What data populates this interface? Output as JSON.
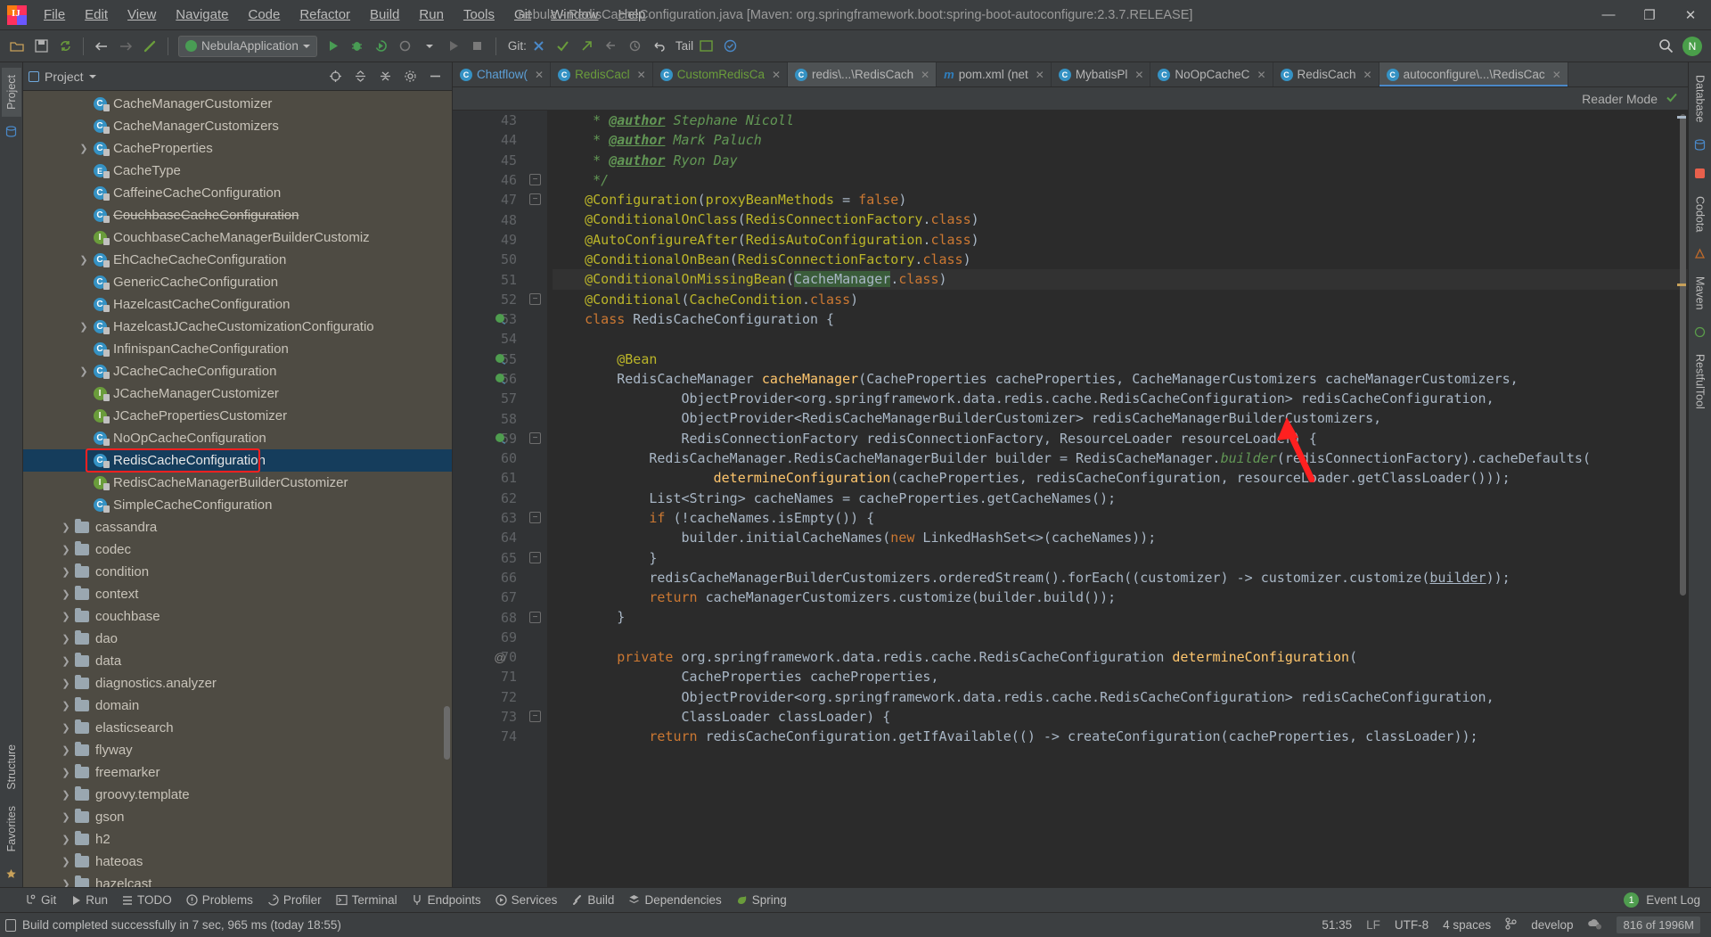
{
  "window": {
    "title": "nebula - RedisCacheConfiguration.java [Maven: org.springframework.boot:spring-boot-autoconfigure:2.3.7.RELEASE]",
    "minimize": "—",
    "maximize": "❐",
    "close": "✕"
  },
  "menu": [
    {
      "label": "File"
    },
    {
      "label": "Edit"
    },
    {
      "label": "View"
    },
    {
      "label": "Navigate"
    },
    {
      "label": "Code"
    },
    {
      "label": "Refactor"
    },
    {
      "label": "Build"
    },
    {
      "label": "Run"
    },
    {
      "label": "Tools"
    },
    {
      "label": "Git"
    },
    {
      "label": "Window"
    },
    {
      "label": "Help"
    }
  ],
  "toolbar": {
    "run_config": "NebulaApplication",
    "git_label": "Git:",
    "tail_label": "Tail",
    "avatar_initial": "N"
  },
  "left_rail": {
    "project": "Project",
    "structure": "Structure",
    "favorites": "Favorites"
  },
  "right_rail": {
    "database": "Database",
    "codota": "Codota",
    "maven": "Maven",
    "restful": "RestfulTool"
  },
  "project_panel": {
    "title": "Project",
    "tree": [
      {
        "indent": 3,
        "icon": "class",
        "label": "CacheManagerCustomizer",
        "twist": false,
        "clipped": true
      },
      {
        "indent": 3,
        "icon": "class",
        "label": "CacheManagerCustomizers",
        "twist": false
      },
      {
        "indent": 3,
        "icon": "class",
        "label": "CacheProperties",
        "twist": true
      },
      {
        "indent": 3,
        "icon": "enum",
        "label": "CacheType",
        "twist": false
      },
      {
        "indent": 3,
        "icon": "class",
        "label": "CaffeineCacheConfiguration",
        "twist": false
      },
      {
        "indent": 3,
        "icon": "class",
        "label": "CouchbaseCacheConfiguration",
        "twist": false,
        "strike": true
      },
      {
        "indent": 3,
        "icon": "iface",
        "label": "CouchbaseCacheManagerBuilderCustomiz",
        "twist": false
      },
      {
        "indent": 3,
        "icon": "class",
        "label": "EhCacheCacheConfiguration",
        "twist": true
      },
      {
        "indent": 3,
        "icon": "class",
        "label": "GenericCacheConfiguration",
        "twist": false
      },
      {
        "indent": 3,
        "icon": "class",
        "label": "HazelcastCacheConfiguration",
        "twist": false
      },
      {
        "indent": 3,
        "icon": "class",
        "label": "HazelcastJCacheCustomizationConfiguratio",
        "twist": true
      },
      {
        "indent": 3,
        "icon": "class",
        "label": "InfinispanCacheConfiguration",
        "twist": false
      },
      {
        "indent": 3,
        "icon": "class",
        "label": "JCacheCacheConfiguration",
        "twist": true
      },
      {
        "indent": 3,
        "icon": "iface",
        "label": "JCacheManagerCustomizer",
        "twist": false
      },
      {
        "indent": 3,
        "icon": "iface",
        "label": "JCachePropertiesCustomizer",
        "twist": false
      },
      {
        "indent": 3,
        "icon": "class",
        "label": "NoOpCacheConfiguration",
        "twist": false
      },
      {
        "indent": 3,
        "icon": "class",
        "label": "RedisCacheConfiguration",
        "twist": false,
        "selected": true,
        "highlight": true
      },
      {
        "indent": 3,
        "icon": "iface",
        "label": "RedisCacheManagerBuilderCustomizer",
        "twist": false
      },
      {
        "indent": 3,
        "icon": "class",
        "label": "SimpleCacheConfiguration",
        "twist": false
      },
      {
        "indent": 2,
        "icon": "folder",
        "label": "cassandra",
        "twist": true
      },
      {
        "indent": 2,
        "icon": "folder",
        "label": "codec",
        "twist": true
      },
      {
        "indent": 2,
        "icon": "folder",
        "label": "condition",
        "twist": true
      },
      {
        "indent": 2,
        "icon": "folder",
        "label": "context",
        "twist": true
      },
      {
        "indent": 2,
        "icon": "folder",
        "label": "couchbase",
        "twist": true
      },
      {
        "indent": 2,
        "icon": "folder",
        "label": "dao",
        "twist": true
      },
      {
        "indent": 2,
        "icon": "folder",
        "label": "data",
        "twist": true
      },
      {
        "indent": 2,
        "icon": "folder",
        "label": "diagnostics.analyzer",
        "twist": true
      },
      {
        "indent": 2,
        "icon": "folder",
        "label": "domain",
        "twist": true
      },
      {
        "indent": 2,
        "icon": "folder",
        "label": "elasticsearch",
        "twist": true
      },
      {
        "indent": 2,
        "icon": "folder",
        "label": "flyway",
        "twist": true
      },
      {
        "indent": 2,
        "icon": "folder",
        "label": "freemarker",
        "twist": true
      },
      {
        "indent": 2,
        "icon": "folder",
        "label": "groovy.template",
        "twist": true
      },
      {
        "indent": 2,
        "icon": "folder",
        "label": "gson",
        "twist": true
      },
      {
        "indent": 2,
        "icon": "folder",
        "label": "h2",
        "twist": true
      },
      {
        "indent": 2,
        "icon": "folder",
        "label": "hateoas",
        "twist": true
      },
      {
        "indent": 2,
        "icon": "folder",
        "label": "hazelcast",
        "twist": true
      }
    ]
  },
  "editor_tabs": [
    {
      "label": "Chatflow(",
      "icon": "class",
      "color": "blue",
      "active": false
    },
    {
      "label": "RedisCacl",
      "icon": "class",
      "color": "green",
      "active": false
    },
    {
      "label": "CustomRedisCa",
      "icon": "class",
      "color": "green",
      "active": false
    },
    {
      "label": "redis\\...\\RedisCach",
      "icon": "class",
      "color": "grey",
      "active": true
    },
    {
      "label": "pom.xml (net",
      "icon": "maven",
      "color": "grey",
      "active": false
    },
    {
      "label": "MybatisPl",
      "icon": "class",
      "color": "grey",
      "active": false
    },
    {
      "label": "NoOpCacheC",
      "icon": "class",
      "color": "grey",
      "active": false
    },
    {
      "label": "RedisCach",
      "icon": "class",
      "color": "grey",
      "active": false
    },
    {
      "label": "autoconfigure\\...\\RedisCac",
      "icon": "class",
      "color": "grey",
      "active": true,
      "current": true
    }
  ],
  "reader_mode": {
    "label": "Reader Mode"
  },
  "code": {
    "first_line": 43,
    "highlighted_token": "CacheManager",
    "current_line": 51,
    "lines": [
      {
        "n": 43,
        "html": "     <span class=\"cmt\">* </span><span class=\"cmt-b\">@author</span><span class=\"cmt\"> Stephane Nicoll</span>"
      },
      {
        "n": 44,
        "html": "     <span class=\"cmt\">* </span><span class=\"cmt-b\">@author</span><span class=\"cmt\"> Mark Paluch</span>"
      },
      {
        "n": 45,
        "html": "     <span class=\"cmt\">* </span><span class=\"cmt-b\">@author</span><span class=\"cmt\"> Ryon Day</span>"
      },
      {
        "n": 46,
        "html": "     <span class=\"cmt\">*/</span>"
      },
      {
        "n": 47,
        "html": "    <span class=\"ann\">@Configuration</span>(<span class=\"ann\">proxyBeanMethods</span> = <span class=\"kw\">false</span>)"
      },
      {
        "n": 48,
        "html": "    <span class=\"ann\">@ConditionalOnClass</span>(<span class=\"ann\">RedisConnectionFactory</span>.<span class=\"kw\">class</span>)"
      },
      {
        "n": 49,
        "html": "    <span class=\"ann\">@AutoConfigureAfter</span>(<span class=\"ann\">RedisAutoConfiguration</span>.<span class=\"kw\">class</span>)"
      },
      {
        "n": 50,
        "html": "    <span class=\"ann\">@ConditionalOnBean</span>(<span class=\"ann\">RedisConnectionFactory</span>.<span class=\"kw\">class</span>)"
      },
      {
        "n": 51,
        "html": "    <span class=\"ann\">@ConditionalOnMissingBean</span>(<span class=\"hl\">CacheManager</span>.<span class=\"kw\">class</span>)",
        "current": true
      },
      {
        "n": 52,
        "html": "    <span class=\"ann\">@Conditional</span>(<span class=\"ann\">CacheCondition</span>.<span class=\"kw\">class</span>)"
      },
      {
        "n": 53,
        "html": "    <span class=\"kw\">class</span> RedisCacheConfiguration {"
      },
      {
        "n": 54,
        "html": ""
      },
      {
        "n": 55,
        "html": "        <span class=\"ann\">@Bean</span>"
      },
      {
        "n": 56,
        "html": "        RedisCacheManager <span class=\"fn\">cacheManager</span>(CacheProperties cacheProperties, CacheManagerCustomizers cacheManagerCustomizers,"
      },
      {
        "n": 57,
        "html": "                ObjectProvider&lt;org.springframework.data.redis.cache.RedisCacheConfiguration&gt; redisCacheConfiguration,"
      },
      {
        "n": 58,
        "html": "                ObjectProvider&lt;RedisCacheManagerBuilderCustomizer&gt; redisCacheManagerBuilderCustomizers,"
      },
      {
        "n": 59,
        "html": "                RedisConnectionFactory redisConnectionFactory, ResourceLoader resourceLoader) {"
      },
      {
        "n": 60,
        "html": "            RedisCacheManager.RedisCacheManagerBuilder builder = RedisCacheManager.<span class=\"cmt\">builder</span>(redisConnectionFactory).cacheDefaults("
      },
      {
        "n": 61,
        "html": "                    <span class=\"fn\">determineConfiguration</span>(cacheProperties, redisCacheConfiguration, resourceLoader.getClassLoader()));"
      },
      {
        "n": 62,
        "html": "            List&lt;String&gt; cacheNames = cacheProperties.getCacheNames();"
      },
      {
        "n": 63,
        "html": "            <span class=\"kw\">if</span> (!cacheNames.isEmpty()) {"
      },
      {
        "n": 64,
        "html": "                builder.initialCacheNames(<span class=\"kw\">new</span> LinkedHashSet&lt;&gt;(cacheNames));"
      },
      {
        "n": 65,
        "html": "            }"
      },
      {
        "n": 66,
        "html": "            redisCacheManagerBuilderCustomizers.orderedStream().forEach((customizer) -&gt; customizer.customize(<span class=\"ul\">builder</span>));"
      },
      {
        "n": 67,
        "html": "            <span class=\"kw\">return</span> cacheManagerCustomizers.customize(builder.build());"
      },
      {
        "n": 68,
        "html": "        }"
      },
      {
        "n": 69,
        "html": ""
      },
      {
        "n": 70,
        "html": "        <span class=\"kw\">private</span> org.springframework.data.redis.cache.RedisCacheConfiguration <span class=\"fn\">determineConfiguration</span>("
      },
      {
        "n": 71,
        "html": "                CacheProperties cacheProperties,"
      },
      {
        "n": 72,
        "html": "                ObjectProvider&lt;org.springframework.data.redis.cache.RedisCacheConfiguration&gt; redisCacheConfiguration,"
      },
      {
        "n": 73,
        "html": "                ClassLoader classLoader) {"
      },
      {
        "n": 74,
        "html": "            <span class=\"kw\">return</span> redisCacheConfiguration.getIfAvailable(() -&gt; createConfiguration(cacheProperties, classLoader));"
      }
    ]
  },
  "tool_windows": [
    {
      "label": "Git",
      "icon": "git-icon"
    },
    {
      "label": "Run",
      "icon": "run-icon"
    },
    {
      "label": "TODO",
      "icon": "todo-icon"
    },
    {
      "label": "Problems",
      "icon": "problems-icon"
    },
    {
      "label": "Profiler",
      "icon": "profiler-icon"
    },
    {
      "label": "Terminal",
      "icon": "terminal-icon"
    },
    {
      "label": "Endpoints",
      "icon": "endpoints-icon"
    },
    {
      "label": "Services",
      "icon": "services-icon"
    },
    {
      "label": "Build",
      "icon": "build-icon"
    },
    {
      "label": "Dependencies",
      "icon": "dependencies-icon"
    },
    {
      "label": "Spring",
      "icon": "spring-icon"
    }
  ],
  "event_log": {
    "count": "1",
    "label": "Event Log"
  },
  "status": {
    "message": "Build completed successfully in 7 sec, 965 ms (today 18:55)",
    "caret": "51:35",
    "line_sep": "LF",
    "encoding": "UTF-8",
    "indent": "4 spaces",
    "branch": "develop",
    "memory": "816 of 1996M"
  },
  "colors": {
    "accent": "#4a88c7",
    "selection": "#153d5c",
    "annotation": "#ff2020",
    "highlight": "#3a5c3a",
    "panel_bg": "#4e4b43",
    "editor_bg": "#2b2b2b"
  }
}
